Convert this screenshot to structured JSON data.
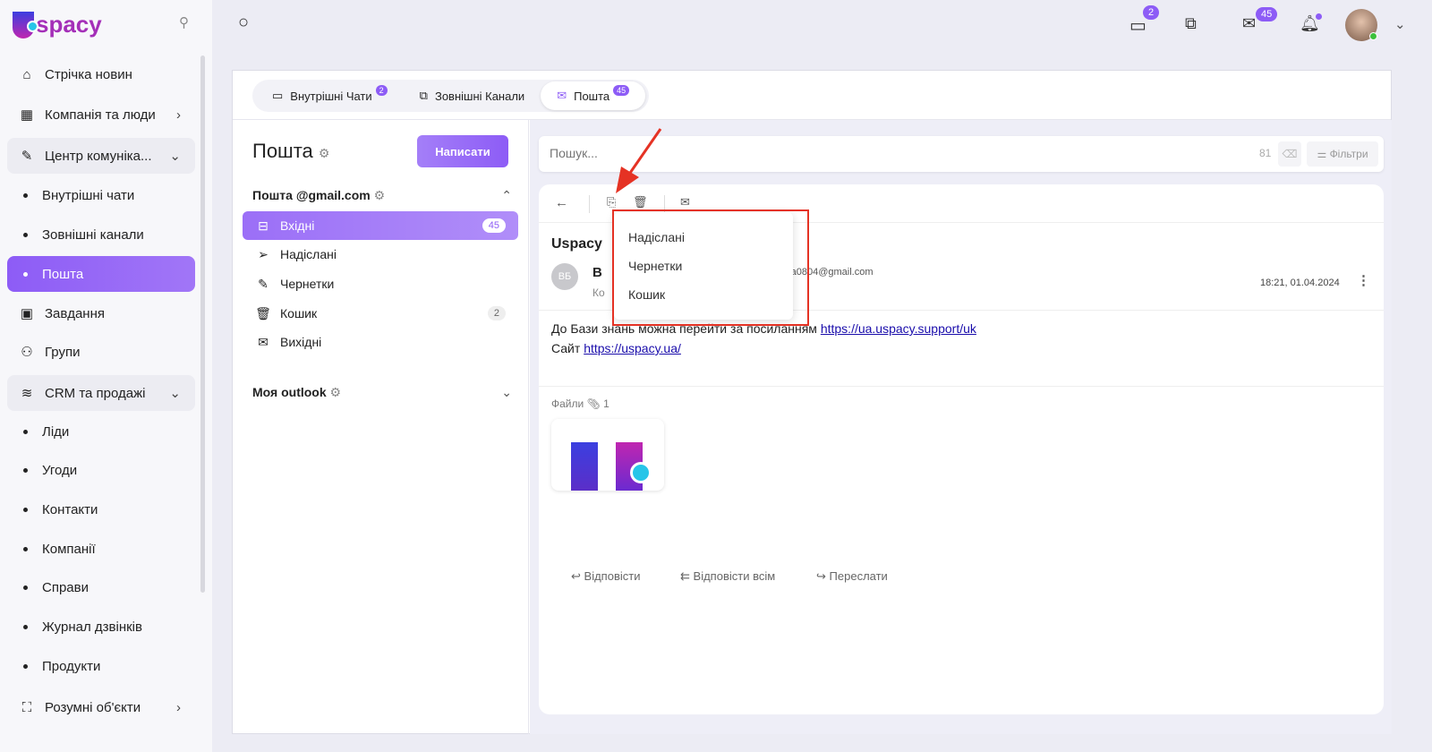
{
  "brand": {
    "logo_text": "spacy"
  },
  "sidebar": {
    "items": [
      {
        "label": "Стрічка новин",
        "icon": "home-icon"
      },
      {
        "label": "Компанія та люди",
        "icon": "building-icon"
      },
      {
        "label": "Центр комуніка...",
        "icon": "chat-edit-icon"
      },
      {
        "label": "Внутрішні чати"
      },
      {
        "label": "Зовнішні канали"
      },
      {
        "label": "Пошта"
      },
      {
        "label": "Завдання",
        "icon": "calendar-icon"
      },
      {
        "label": "Групи",
        "icon": "users-icon"
      },
      {
        "label": "CRM та продажі",
        "icon": "database-icon"
      },
      {
        "label": "Ліди"
      },
      {
        "label": "Угоди"
      },
      {
        "label": "Контакти"
      },
      {
        "label": "Компанії"
      },
      {
        "label": "Справи"
      },
      {
        "label": "Журнал дзвінків"
      },
      {
        "label": "Продукти"
      },
      {
        "label": "Розумні об'єкти",
        "icon": "smart-object-icon"
      }
    ]
  },
  "topbar": {
    "chat_badge": "2",
    "mail_badge": "45"
  },
  "tabs": [
    {
      "label": "Внутрішні Чати",
      "badge": "2"
    },
    {
      "label": "Зовнішні Канали"
    },
    {
      "label": "Пошта",
      "badge": "45"
    }
  ],
  "mail": {
    "title": "Пошта",
    "write_label": "Написати",
    "account1": "Пошта @gmail.com",
    "folders": [
      {
        "label": "Вхідні",
        "count": "45"
      },
      {
        "label": "Надіслані"
      },
      {
        "label": "Чернетки"
      },
      {
        "label": "Кошик",
        "count": "2"
      },
      {
        "label": "Вихідні"
      }
    ],
    "account2": "Моя outlook"
  },
  "search": {
    "placeholder": "Пошук...",
    "count": "81",
    "filters_label": "Фільтри"
  },
  "message": {
    "subject": "Uspacy",
    "avatar": "ВБ",
    "sender_initial": "В",
    "sender_email": "ova0804@gmail.com",
    "to_prefix": "Ко",
    "datetime": "18:21, 01.04.2024",
    "body_line1": "До Бази знань можна перейти за посиланням ",
    "link1": "https://ua.uspacy.support/uk",
    "body_line2": "Сайт ",
    "link2": "https://uspacy.ua/",
    "files_label": "Файли",
    "files_count": "1",
    "reply": "Відповісти",
    "reply_all": "Відповісти всім",
    "forward": "Переслати"
  },
  "move_menu": {
    "items": [
      "Надіслані",
      "Чернетки",
      "Кошик"
    ]
  },
  "colors": {
    "accent": "#8d5cf6",
    "highlight": "#e53224"
  }
}
